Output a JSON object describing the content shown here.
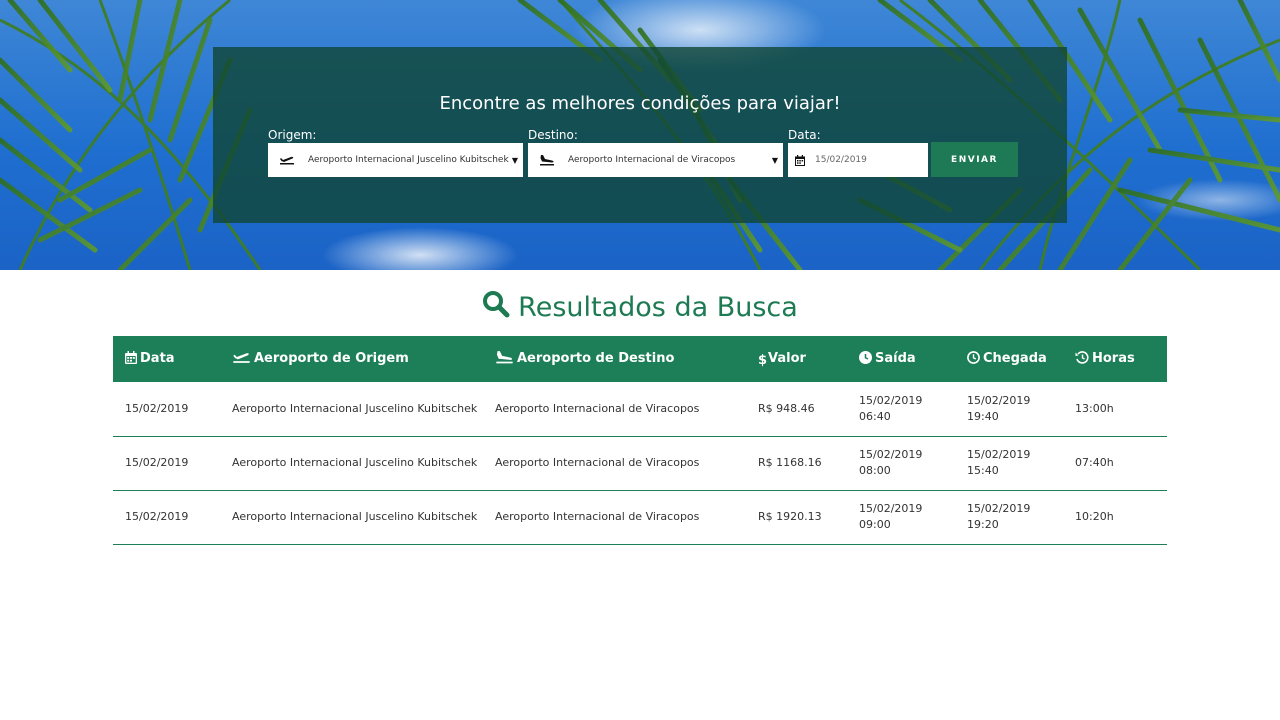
{
  "search": {
    "title": "Encontre as melhores condições para viajar!",
    "origin_label": "Origem:",
    "origin_value": "Aeroporto Internacional Juscelino Kubitschek",
    "destination_label": "Destino:",
    "destination_value": "Aeroporto Internacional de Viracopos",
    "date_label": "Data:",
    "date_value": "15/02/2019",
    "submit_label": "ENVIAR"
  },
  "results": {
    "title": "Resultados da Busca",
    "columns": [
      {
        "label": "Data",
        "icon": "calendar-icon"
      },
      {
        "label": "Aeroporto de Origem",
        "icon": "plane-departure-icon"
      },
      {
        "label": "Aeroporto de  Destino",
        "icon": "plane-arrival-icon"
      },
      {
        "label": "Valor",
        "icon": "dollar-icon"
      },
      {
        "label": "Saída",
        "icon": "clock-filled-icon"
      },
      {
        "label": "Chegada",
        "icon": "clock-outline-icon"
      },
      {
        "label": "Horas",
        "icon": "history-icon"
      }
    ],
    "rows": [
      {
        "date": "15/02/2019",
        "origin": "Aeroporto  Internacional Juscelino  Kubitschek",
        "destination": "Aeroporto  Internacional de Viracopos",
        "price": "R$ 948.46",
        "departure_date": "15/02/2019",
        "departure_time": "06:40",
        "arrival_date": "15/02/2019",
        "arrival_time": "19:40",
        "hours": "13:00h"
      },
      {
        "date": "15/02/2019",
        "origin": "Aeroporto  Internacional Juscelino  Kubitschek",
        "destination": "Aeroporto  Internacional de Viracopos",
        "price": "R$ 1168.16",
        "departure_date": "15/02/2019",
        "departure_time": "08:00",
        "arrival_date": "15/02/2019",
        "arrival_time": "15:40",
        "hours": "07:40h"
      },
      {
        "date": "15/02/2019",
        "origin": "Aeroporto  Internacional Juscelino  Kubitschek",
        "destination": "Aeroporto  Internacional de Viracopos",
        "price": "R$ 1920.13",
        "departure_date": "15/02/2019",
        "departure_time": "09:00",
        "arrival_date": "15/02/2019",
        "arrival_time": "19:20",
        "hours": "10:20h"
      }
    ]
  },
  "colors": {
    "accent": "#1d7f57",
    "panel": "#104634",
    "sky": "#1f6fd0"
  }
}
